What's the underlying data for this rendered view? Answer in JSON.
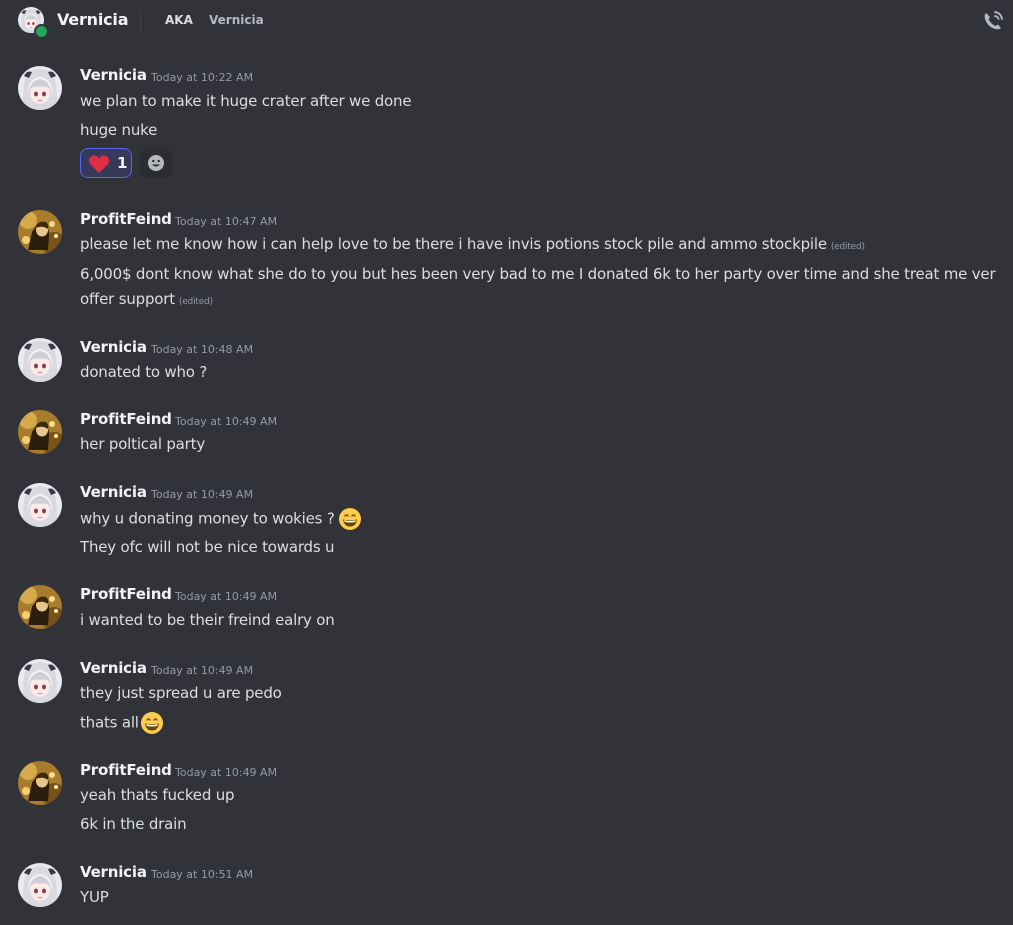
{
  "header": {
    "name": "Vernicia",
    "aka_label": "AKA",
    "aka_name": "Vernicia",
    "call_icon": "phone-call-icon"
  },
  "messages": [
    {
      "author": "Vernicia",
      "timestamp": "Today at 10:22 AM",
      "lines": [
        "we plan to make it huge crater after we done",
        "huge nuke"
      ],
      "reaction": {
        "emoji": "heart-icon",
        "count": "1"
      }
    },
    {
      "author": "ProfitFeind",
      "timestamp": "Today at 10:47 AM",
      "lines": [
        "please let me know how i can help love to be there i have invis potions stock pile and ammo stockpile",
        "6,000$ dont know what she do to you but hes been very bad to me I donated 6k to her party over time and she treat me ver",
        "offer support"
      ],
      "edited_label": "(edited)"
    },
    {
      "author": "Vernicia",
      "timestamp": "Today at 10:48 AM",
      "lines": [
        "donated to who ?"
      ]
    },
    {
      "author": "ProfitFeind",
      "timestamp": "Today at 10:49 AM",
      "lines": [
        "her poltical party"
      ]
    },
    {
      "author": "Vernicia",
      "timestamp": "Today at 10:49 AM",
      "lines": [
        "why u donating money to wokies ?",
        "They ofc will not be nice towards u"
      ],
      "emoji": "grinning-face-icon"
    },
    {
      "author": "ProfitFeind",
      "timestamp": "Today at 10:49 AM",
      "lines": [
        "i wanted to be their freind ealry  on"
      ]
    },
    {
      "author": "Vernicia",
      "timestamp": "Today at 10:49 AM",
      "lines": [
        "they just spread u are pedo",
        "thats all"
      ],
      "emoji": "grinning-face-icon"
    },
    {
      "author": "ProfitFeind",
      "timestamp": "Today at 10:49 AM",
      "lines": [
        "yeah thats fucked up",
        "6k in the drain"
      ]
    },
    {
      "author": "Vernicia",
      "timestamp": "Today at 10:51 AM",
      "lines": [
        "YUP"
      ]
    }
  ],
  "colors": {
    "background": "#313338",
    "username": "#f2f3f5",
    "text": "#dbdee1",
    "muted": "#949ba4",
    "reaction_border": "#5865f2"
  }
}
